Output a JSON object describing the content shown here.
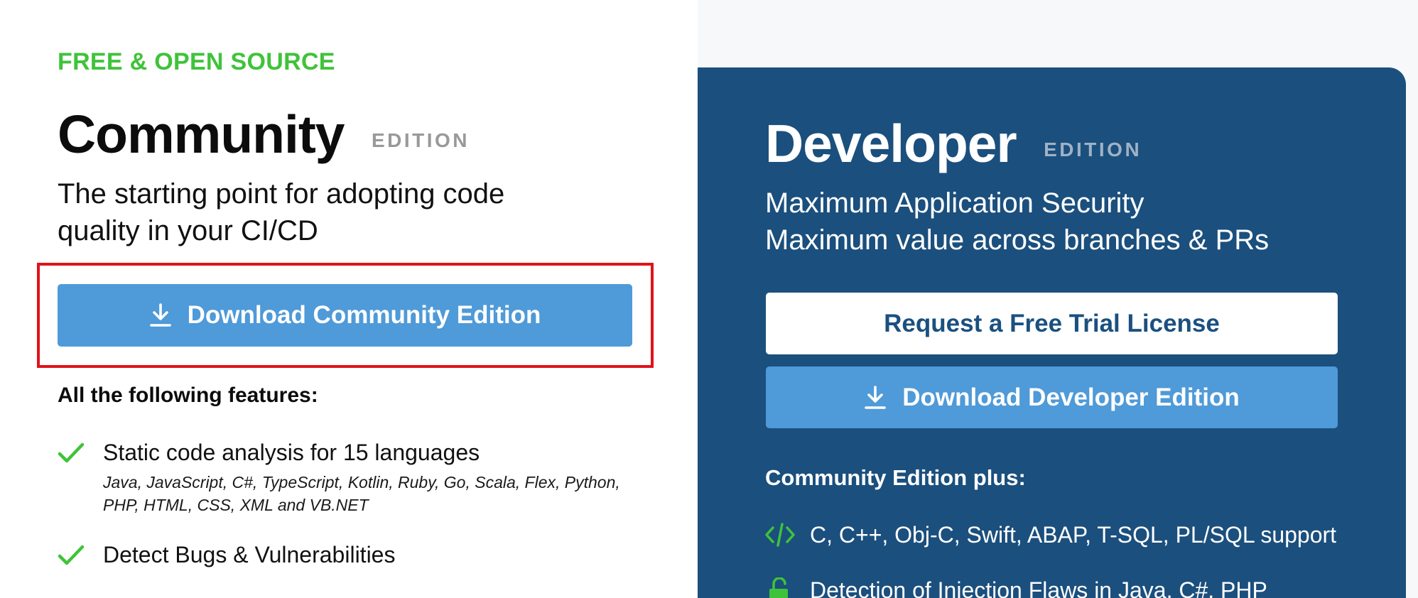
{
  "community": {
    "tagline": "FREE & OPEN SOURCE",
    "title": "Community",
    "edition_badge": "EDITION",
    "subtitle_line1": "The starting point for adopting code",
    "subtitle_line2": "quality in your CI/CD",
    "download_button": "Download Community Edition",
    "features_heading": "All the following features:",
    "features": [
      {
        "label": "Static code analysis for 15 languages",
        "detail": "Java, JavaScript, C#, TypeScript, Kotlin, Ruby, Go, Scala, Flex, Python, PHP, HTML, CSS, XML and VB.NET"
      },
      {
        "label": "Detect Bugs & Vulnerabilities"
      }
    ]
  },
  "developer": {
    "title": "Developer",
    "edition_badge": "EDITION",
    "subtitle_line1": "Maximum Application Security",
    "subtitle_line2": "Maximum value across branches & PRs",
    "trial_button": "Request a Free Trial License",
    "download_button": "Download Developer Edition",
    "features_heading": "Community Edition plus:",
    "features": [
      {
        "icon": "code-icon",
        "label": "C, C++, Obj-C, Swift, ABAP, T-SQL, PL/SQL support"
      },
      {
        "icon": "unlock-icon",
        "label": "Detection of Injection Flaws in Java, C#, PHP"
      }
    ]
  },
  "colors": {
    "accent_green": "#3fc33a",
    "button_blue": "#4f9ad8",
    "developer_panel": "#1b4f7d",
    "highlight_red": "#e0131a"
  }
}
